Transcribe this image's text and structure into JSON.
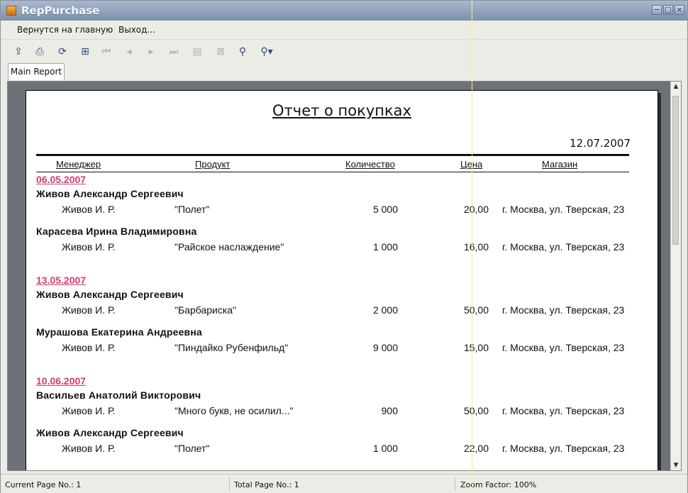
{
  "window": {
    "title": "RepPurchase"
  },
  "menu": {
    "items": [
      "Вернутся на главную",
      "Выход..."
    ]
  },
  "tabs": {
    "main": "Main Report"
  },
  "report": {
    "title": "Отчет о покупках",
    "date": "12.07.2007",
    "columns": {
      "manager": "Менеджер",
      "product": "Продукт",
      "quantity": "Количество",
      "price": "Цена",
      "shop": "Магазин"
    },
    "groups": [
      {
        "date": "06.05.2007",
        "orders": [
          {
            "customer": "Живов Александр Сергеевич",
            "manager": "Живов И. Р.",
            "product": "\"Полет\"",
            "quantity": "5 000",
            "price": "20,00",
            "shop": "г. Москва, ул. Тверская, 23"
          },
          {
            "customer": "Карасева Ирина Владимировна",
            "manager": "Живов И. Р.",
            "product": "\"Райское наслаждение\"",
            "quantity": "1 000",
            "price": "16,00",
            "shop": "г. Москва, ул. Тверская, 23"
          }
        ]
      },
      {
        "date": "13.05.2007",
        "orders": [
          {
            "customer": "Живов Александр Сергеевич",
            "manager": "Живов И. Р.",
            "product": "\"Барбариска\"",
            "quantity": "2 000",
            "price": "50,00",
            "shop": "г. Москва, ул. Тверская, 23"
          },
          {
            "customer": "Мурашова Екатерина Андреевна",
            "manager": "Живов И. Р.",
            "product": "\"Пиндайко Рубенфильд\"",
            "quantity": "9 000",
            "price": "15,00",
            "shop": "г. Москва, ул. Тверская, 23"
          }
        ]
      },
      {
        "date": "10.06.2007",
        "orders": [
          {
            "customer": "Васильев Анатолий Викторович",
            "manager": "Живов И. Р.",
            "product": "\"Много букв, не осилил...\"",
            "quantity": "900",
            "price": "50,00",
            "shop": "г. Москва, ул. Тверская, 23"
          },
          {
            "customer": "Живов Александр Сергеевич",
            "manager": "Живов И. Р.",
            "product": "\"Полет\"",
            "quantity": "1 000",
            "price": "22,00",
            "shop": "г. Москва, ул. Тверская, 23"
          }
        ]
      }
    ]
  },
  "status": {
    "current_page": "Current Page No.: 1",
    "total_page": "Total Page No.: 1",
    "zoom": "Zoom Factor: 100%"
  },
  "icons": [
    "export-icon",
    "print-icon",
    "refresh-icon",
    "group-tree-icon",
    "first-page-icon",
    "prev-page-icon",
    "next-page-icon",
    "last-page-icon",
    "goto-page-icon",
    "stop-icon",
    "search-icon",
    "zoom-icon"
  ]
}
